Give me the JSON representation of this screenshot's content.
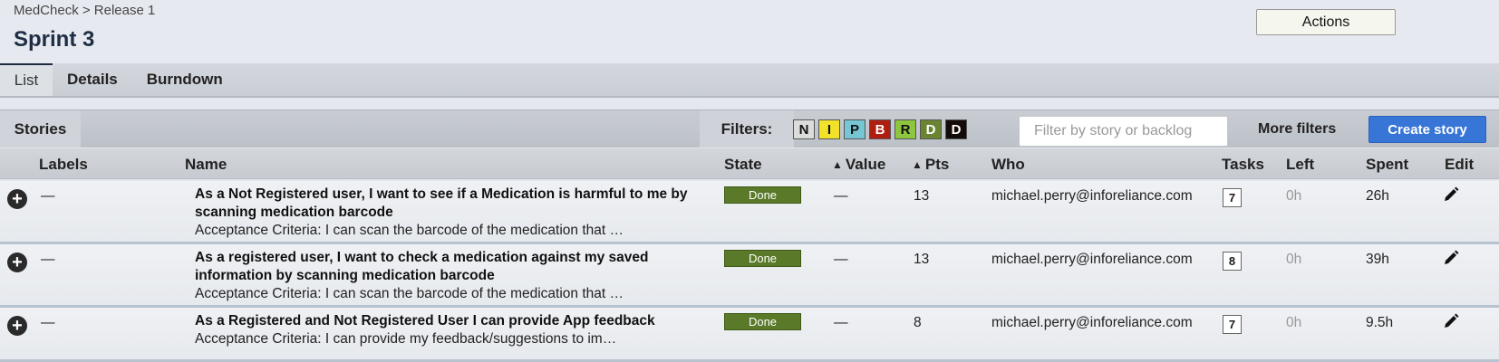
{
  "breadcrumb": "MedCheck > Release 1",
  "page_title": "Sprint 3",
  "actions_label": "Actions",
  "tabs": [
    {
      "label": "List",
      "active": true
    },
    {
      "label": "Details",
      "active": false
    },
    {
      "label": "Burndown",
      "active": false
    }
  ],
  "toolbar": {
    "stories_label": "Stories",
    "filters_label": "Filters:",
    "state_filters": [
      {
        "label": "N",
        "color": "#dcdcdc",
        "text": "#111"
      },
      {
        "label": "I",
        "color": "#f2e22a",
        "text": "#111"
      },
      {
        "label": "P",
        "color": "#76c6d4",
        "text": "#111"
      },
      {
        "label": "B",
        "color": "#b01e12",
        "text": "#fff"
      },
      {
        "label": "R",
        "color": "#8ec63f",
        "text": "#111"
      },
      {
        "label": "D",
        "color": "#6b8431",
        "text": "#fff"
      },
      {
        "label": "D",
        "color": "#140a0a",
        "text": "#fff"
      }
    ],
    "search_placeholder": "Filter by story or backlog",
    "more_filters_label": "More filters",
    "create_story_label": "Create story"
  },
  "columns": {
    "labels": "Labels",
    "name": "Name",
    "state": "State",
    "value": "Value",
    "pts": "Pts",
    "who": "Who",
    "tasks": "Tasks",
    "left": "Left",
    "spent": "Spent",
    "edit": "Edit"
  },
  "stories": [
    {
      "labels": "—",
      "name": "As a Not Registered user, I want to see if a Medication is harmful to me by scanning medication barcode",
      "description": "Acceptance Criteria: I can scan the barcode of the medication that …",
      "state": "Done",
      "value": "—",
      "pts": "13",
      "who": "michael.perry@inforeliance.com",
      "tasks": "7",
      "left": "0h",
      "spent": "26h"
    },
    {
      "labels": "—",
      "name": "As a registered user, I want to check a medication against my saved information by scanning medication barcode",
      "description": "Acceptance Criteria: I can scan the barcode of the medication that …",
      "state": "Done",
      "value": "—",
      "pts": "13",
      "who": "michael.perry@inforeliance.com",
      "tasks": "8",
      "left": "0h",
      "spent": "39h"
    },
    {
      "labels": "—",
      "name": "As a Registered and Not Registered User I can provide App feedback",
      "description": "Acceptance Criteria: I can provide my feedback/suggestions to im…",
      "state": "Done",
      "value": "—",
      "pts": "8",
      "who": "michael.perry@inforeliance.com",
      "tasks": "7",
      "left": "0h",
      "spent": "9.5h"
    }
  ],
  "colors": {
    "done_state": "#5a7a2a",
    "create_button": "#3775d6",
    "title": "#1f2d44"
  }
}
